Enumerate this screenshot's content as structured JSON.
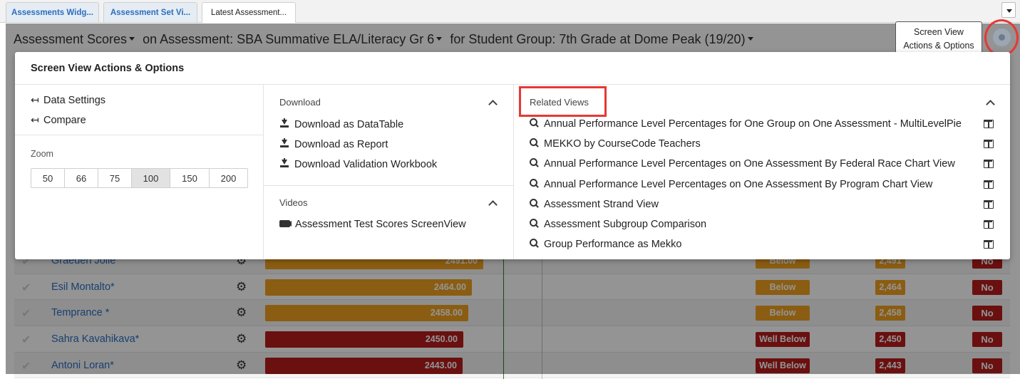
{
  "tabs": [
    "Assessments Widg...",
    "Assessment Set Vi...",
    "Latest Assessment..."
  ],
  "header": {
    "measure": "Assessment Scores",
    "assessment_label": "on Assessment:",
    "assessment": "SBA Summative ELA/Literacy Gr 6",
    "group_label": "for Student Group:",
    "group": "7th Grade at Dome Peak (19/20)"
  },
  "tooltip": {
    "line1": "Screen View",
    "line2": "Actions & Options"
  },
  "modal": {
    "title": "Screen View Actions & Options",
    "actions": [
      "Data Settings",
      "Compare"
    ],
    "zoom_label": "Zoom",
    "zoom_levels": [
      "50",
      "66",
      "75",
      "100",
      "150",
      "200"
    ],
    "zoom_selected": "100",
    "download": {
      "heading": "Download",
      "items": [
        "Download as DataTable",
        "Download as Report",
        "Download Validation Workbook"
      ]
    },
    "videos": {
      "heading": "Videos",
      "items": [
        "Assessment Test Scores ScreenView"
      ]
    },
    "related": {
      "heading": "Related Views",
      "items": [
        "Annual Performance Level Percentages for One Group on One Assessment - MultiLevelPie",
        "MEKKO by CourseCode Teachers",
        "Annual Performance Level Percentages on One Assessment By Federal Race Chart View",
        "Annual Performance Level Percentages on One Assessment By Program Chart View",
        "Assessment Strand View",
        "Assessment Subgroup Comparison",
        "Group Performance as Mekko"
      ]
    }
  },
  "students": [
    {
      "name": "Graeden Jolie",
      "score": "2491.00",
      "level": "Below",
      "scaled": "2,491",
      "met": "No",
      "color": "orange"
    },
    {
      "name": "Esil Montalto*",
      "score": "2464.00",
      "level": "Below",
      "scaled": "2,464",
      "met": "No",
      "color": "orange"
    },
    {
      "name": "Temprance *",
      "score": "2458.00",
      "level": "Below",
      "scaled": "2,458",
      "met": "No",
      "color": "orange"
    },
    {
      "name": "Sahra Kavahikava*",
      "score": "2450.00",
      "level": "Well Below",
      "scaled": "2,450",
      "met": "No",
      "color": "red"
    },
    {
      "name": "Antoni Loran*",
      "score": "2443.00",
      "level": "Well Below",
      "scaled": "2,443",
      "met": "No",
      "color": "red"
    }
  ],
  "colors": {
    "orange": "#f0a020",
    "red": "#b71c1c",
    "highlight": "#e53935",
    "link": "#2a6ebf"
  }
}
